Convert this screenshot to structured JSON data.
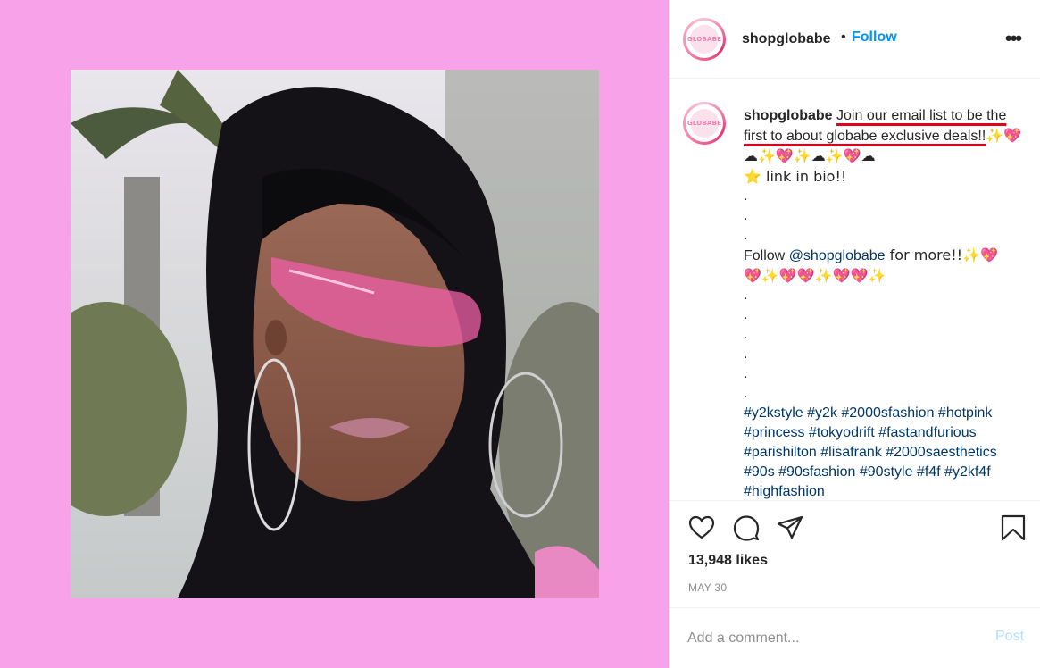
{
  "post": {
    "username": "shopglobabe",
    "avatar_text": "GLOBABE",
    "dot": "•",
    "follow_label": "Follow",
    "more_label": "•••"
  },
  "caption": {
    "username": "shopglobabe",
    "line1_highlight": "Join our email list to be the first to about globabe exclusive deals!!",
    "line1_emoji": "✨💖☁✨💖✨☁✨💖☁",
    "line2": "⭐ link in bio!!",
    "dots_a": [
      ".",
      ".",
      "."
    ],
    "follow_prefix": "Follow ",
    "mention": "@shopglobabe",
    "follow_suffix": " for more!!✨💖",
    "emoji_row": "💖✨💖💖✨💖💖✨",
    "dots_b": [
      ".",
      ".",
      ".",
      ".",
      ".",
      "."
    ],
    "hashtags": "#y2kstyle #y2k #2000sfashion #hotpink #princess #tokyodrift #fastandfurious #parishilton #lisafrank #2000saesthetics #90s #90sfashion #90style #f4f #y2kf4f #highfashion"
  },
  "actions": {
    "like_icon": "heart-icon",
    "comment_icon": "comment-icon",
    "share_icon": "share-icon",
    "save_icon": "bookmark-icon"
  },
  "likes": "13,948 likes",
  "date": "MAY 30",
  "comment": {
    "placeholder": "Add a comment...",
    "post_label": "Post"
  },
  "colors": {
    "media_background": "#f8a3e9",
    "link_blue": "#00376b",
    "follow_blue": "#0095f6",
    "underline_red": "#e0001b"
  }
}
